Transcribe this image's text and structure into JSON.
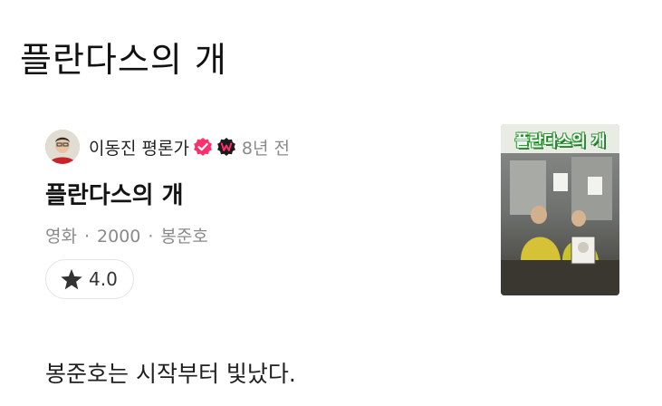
{
  "page": {
    "title": "플란다스의 개"
  },
  "review": {
    "author": "이동진 평론가",
    "time_ago": "8년 전",
    "movie_title": "플란다스의 개",
    "category": "영화",
    "year": "2000",
    "director": "봉준호",
    "separator": "·",
    "rating": "4.0",
    "rating_value": 4.0,
    "text": "봉준호는 시작부터 빛났다.",
    "poster_title": "플란다스의 개"
  },
  "badges": {
    "verified_icon": "verified-check-icon",
    "watcha_icon": "w-badge-icon",
    "verified_color": "#ff2f6e",
    "watcha_color": "#1b1b1b"
  },
  "colors": {
    "text_primary": "#141414",
    "text_secondary": "#8a8a8a",
    "chip_border": "#e3e3e3"
  }
}
